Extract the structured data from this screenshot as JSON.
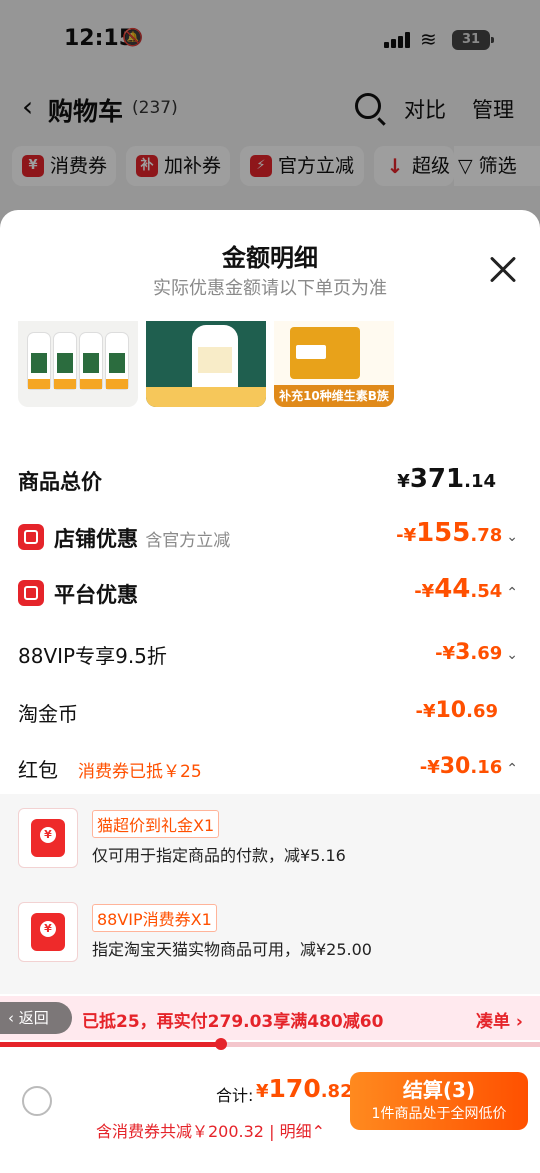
{
  "status_bar": {
    "time": "12:15",
    "battery": "31"
  },
  "nav": {
    "back": "‹",
    "title": "购物车",
    "count": "(237)",
    "compare": "对比",
    "manage": "管理"
  },
  "chips": [
    {
      "icon": "¥",
      "label": "消费券"
    },
    {
      "icon": "补",
      "label": "加补券"
    },
    {
      "icon": "⚡",
      "label": "官方立减"
    },
    {
      "icon": "↓",
      "label": "超级"
    }
  ],
  "filter_label": "筛选",
  "sheet": {
    "title": "金额明细",
    "subtitle": "实际优惠金额请以下单页为准",
    "thumb3_caption": "补充10种维生素B族"
  },
  "breakdown": {
    "total": {
      "label": "商品总价",
      "currency": "¥",
      "int": "371",
      "dec": ".14"
    },
    "store": {
      "label": "店铺优惠",
      "note": "含官方立减",
      "prefix": "-¥",
      "int": "155",
      "dec": ".78"
    },
    "platform": {
      "label": "平台优惠",
      "prefix": "-¥",
      "int": "44",
      "dec": ".54"
    },
    "vip": {
      "label": "88VIP专享9.5折",
      "prefix": "-¥",
      "int": "3",
      "dec": ".69"
    },
    "coins": {
      "label": "淘金币",
      "prefix": "-¥",
      "int": "10",
      "dec": ".69"
    },
    "redpacket": {
      "label": "红包",
      "note": "消费券已抵￥25",
      "prefix": "-¥",
      "int": "30",
      "dec": ".16"
    }
  },
  "coupons": [
    {
      "tag": "猫超价到礼金X1",
      "desc": "仅可用于指定商品的付款，减¥5.16"
    },
    {
      "tag": "88VIP消费券X1",
      "desc": "指定淘宝天猫实物商品可用，减¥25.00"
    }
  ],
  "promo": {
    "back_label": "返回",
    "text": "已抵25，再实付279.03享满480减60",
    "action": "凑单 ›",
    "progress": 0.41
  },
  "footer": {
    "total_label": "合计:",
    "total_prefix": "¥",
    "total_int": "170",
    "total_dec": ".82",
    "saved": "含消费券共减￥200.32",
    "detail": "明细",
    "checkout": "结算(3)",
    "checkout_sub": "1件商品处于全网低价"
  },
  "colors": {
    "accent": "#ff5000",
    "brand_red": "#e5242a"
  }
}
